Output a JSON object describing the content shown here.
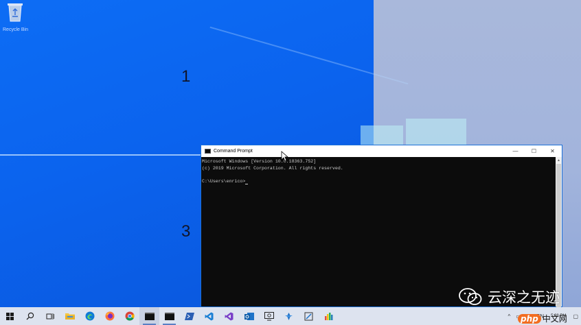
{
  "desktop": {
    "recycle_bin_label": "Recycle Bin",
    "zone_labels": [
      "1",
      "3"
    ],
    "colors": {
      "left_zone": "#0b63ee",
      "right_zone": "#a2b4dc",
      "taskbar": "#dde3ef"
    }
  },
  "cmd_window": {
    "title": "Command Prompt",
    "lines": [
      "Microsoft Windows [Version 10.0.18363.752]",
      "(c) 2019 Microsoft Corporation. All rights reserved.",
      "",
      "C:\\Users\\enrico>"
    ],
    "controls": {
      "minimize": "—",
      "maximize": "☐",
      "close": "✕"
    }
  },
  "taskbar": {
    "items": [
      {
        "name": "start-button",
        "icon": "windows-icon"
      },
      {
        "name": "search-button",
        "icon": "search-icon"
      },
      {
        "name": "task-view-button",
        "icon": "task-view-icon"
      },
      {
        "name": "file-explorer",
        "icon": "folder-icon"
      },
      {
        "name": "edge-browser",
        "icon": "edge-icon"
      },
      {
        "name": "firefox-browser",
        "icon": "firefox-icon"
      },
      {
        "name": "chrome-browser",
        "icon": "chrome-icon"
      },
      {
        "name": "command-prompt-task",
        "icon": "terminal-icon"
      },
      {
        "name": "terminal-2-task",
        "icon": "terminal-icon"
      },
      {
        "name": "powershell-task",
        "icon": "powershell-icon"
      },
      {
        "name": "vscode-task",
        "icon": "vscode-icon"
      },
      {
        "name": "visual-studio-task",
        "icon": "visual-studio-icon"
      },
      {
        "name": "outlook-task",
        "icon": "outlook-icon"
      },
      {
        "name": "screen-tool-task",
        "icon": "screen-icon"
      },
      {
        "name": "app-14-task",
        "icon": "app-icon"
      },
      {
        "name": "app-15-task",
        "icon": "app-icon"
      },
      {
        "name": "app-16-task",
        "icon": "app-icon"
      }
    ],
    "tray": {
      "language": "EN",
      "time": "5:38 PM"
    }
  },
  "watermarks": {
    "wechat_text": "云深之无迹",
    "php_badge": "php",
    "php_cn": "中文网"
  }
}
